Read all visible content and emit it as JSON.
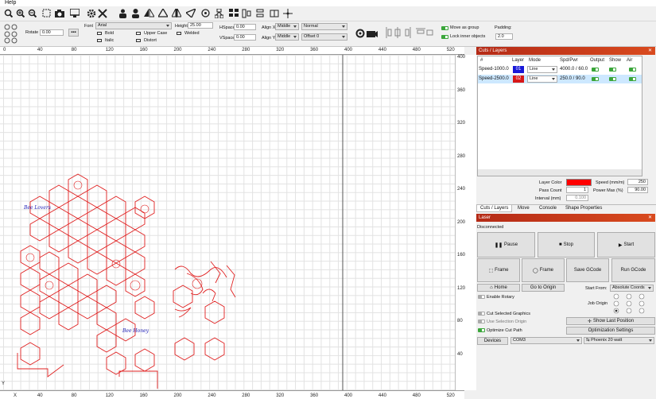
{
  "menu": {
    "help": "Help"
  },
  "toolbar2": {
    "rotate_label": "Rotate",
    "rotate_value": "0.00",
    "font_label": "Font",
    "font_value": "Arial",
    "height_label": "Height",
    "height_value": "25.00",
    "bold_label": "Bold",
    "italic_label": "Italic",
    "upper_case_label": "Upper Case",
    "distort_label": "Distort",
    "welded_label": "Welded",
    "hspace_label": "HSpace",
    "hspace_value": "0.00",
    "vspace_label": "VSpace",
    "vspace_value": "0.00",
    "align_x_label": "Align X",
    "align_x_value": "Middle",
    "align_y_label": "Align Y",
    "align_y_value": "Middle",
    "normal_value": "Normal",
    "offset_value": "Offset 0",
    "move_as_group_label": "Move as group",
    "lock_inner_label": "Lock inner objects",
    "padding_label": "Padding:",
    "padding_value": "2.0"
  },
  "ruler": {
    "top": [
      "0",
      "40",
      "80",
      "120",
      "160",
      "200",
      "240",
      "280",
      "320",
      "360",
      "400",
      "440",
      "480",
      "520"
    ],
    "bottom": [
      "0",
      "40",
      "80",
      "120",
      "160",
      "200",
      "240",
      "280",
      "320",
      "360",
      "400",
      "440",
      "480",
      "520"
    ],
    "right": [
      "400",
      "360",
      "320",
      "280",
      "240",
      "200",
      "160",
      "120",
      "80",
      "40"
    ],
    "y_label": "Y",
    "x_label": "X"
  },
  "canvas_text": {
    "bee1": "Bee Lovers",
    "bee2": "Bee Honey"
  },
  "cuts": {
    "title": "Cuts / Layers",
    "headers": [
      "#",
      "Layer",
      "Mode",
      "Spd/Pwr",
      "Output",
      "Show",
      "Air"
    ],
    "rows": [
      {
        "name": "Speed-1000.0",
        "layer": "01",
        "color": "#1818d8",
        "mode": "Line",
        "spdpwr": "4000.0 / 60.0"
      },
      {
        "name": "Speed-2500.0",
        "layer": "02",
        "color": "#d81818",
        "mode": "Line",
        "spdpwr": "250.0 / 90.0"
      }
    ],
    "layer_color_label": "Layer Color",
    "layer_color": "#ff0000",
    "speed_label": "Speed (mm/m)",
    "speed_value": "250",
    "pass_count_label": "Pass Count",
    "pass_count_value": "1",
    "power_max_label": "Power Max (%)",
    "power_max_value": "90.00",
    "interval_label": "Interval (mm)",
    "interval_value": "0.100",
    "tabs": [
      "Cuts / Layers",
      "Move",
      "Console",
      "Shape Properties"
    ]
  },
  "laser": {
    "title": "Laser",
    "status": "Disconnected",
    "pause": "Pause",
    "stop": "Stop",
    "start": "Start",
    "frame1": "Frame",
    "frame2": "Frame",
    "save_gcode": "Save GCode",
    "run_gcode": "Run GCode",
    "home": "Home",
    "go_to_origin": "Go to Origin",
    "start_from_label": "Start From:",
    "start_from_value": "Absolute Coords",
    "job_origin_label": "Job Origin",
    "enable_rotary": "Enable Rotary",
    "cut_selected": "Cut Selected Graphics",
    "use_selection_origin": "Use Selection Origin",
    "optimize_cut_path": "Optimize Cut Path",
    "show_last_position": "Show Last Position",
    "optimization_settings": "Optimization Settings",
    "devices": "Devices",
    "port": "COM3",
    "device": "Phoenix 20 watt"
  }
}
